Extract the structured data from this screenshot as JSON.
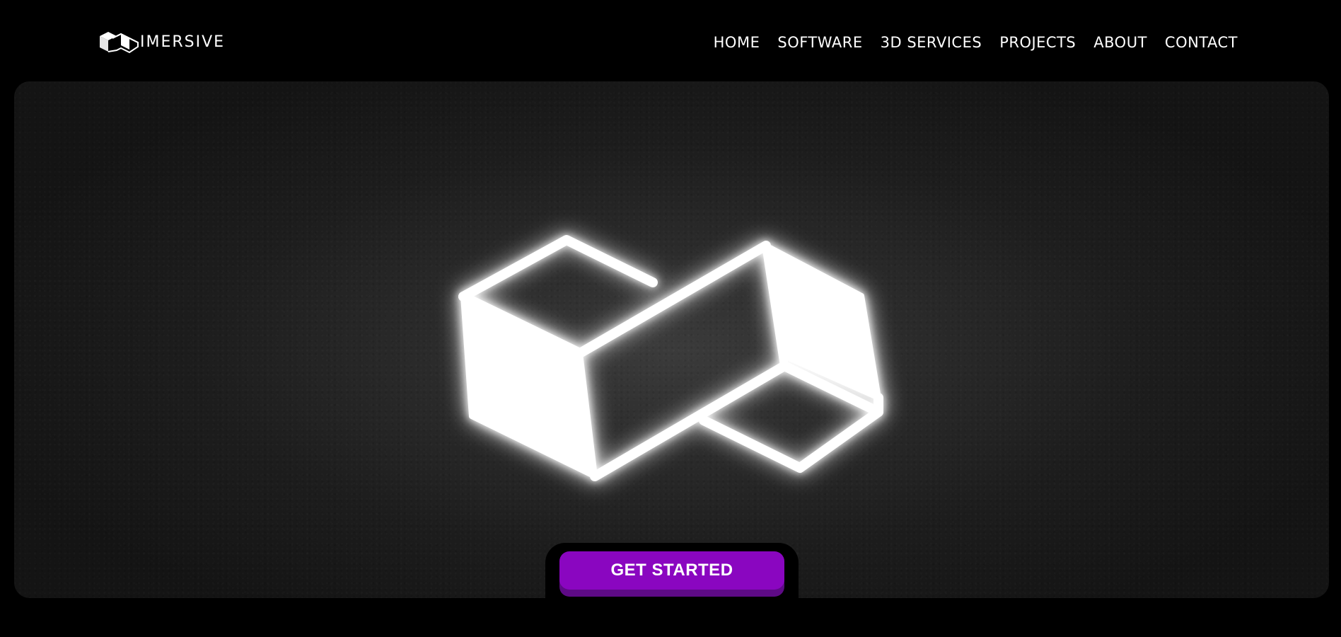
{
  "brand": {
    "name": "IMERSIVE",
    "logo_icon": "cube-logo-icon"
  },
  "nav": {
    "items": [
      {
        "label": "HOME"
      },
      {
        "label": "SOFTWARE"
      },
      {
        "label": "3D SERVICES"
      },
      {
        "label": "PROJECTS"
      },
      {
        "label": "ABOUT"
      },
      {
        "label": "CONTACT"
      }
    ]
  },
  "hero": {
    "logo_icon": "glowing-infinity-cube-logo-icon",
    "cta_label": "GET STARTED"
  },
  "colors": {
    "background": "#000000",
    "text": "#ffffff",
    "accent": "#8a06c0",
    "accent_shadow": "#5e0a86"
  }
}
